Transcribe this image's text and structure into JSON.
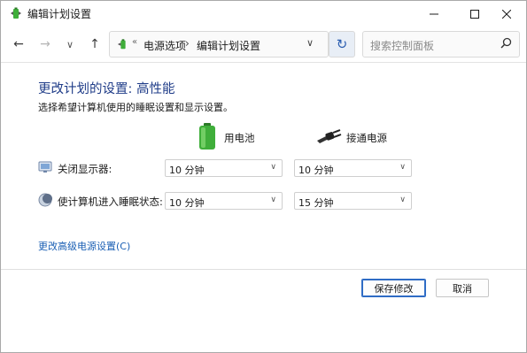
{
  "window": {
    "title": "编辑计划设置"
  },
  "nav": {
    "breadcrumb": [
      "电源选项",
      "编辑计划设置"
    ],
    "search_placeholder": "搜索控制面板",
    "refresh_color": "#2a5db0"
  },
  "main": {
    "title": "更改计划的设置: 高性能",
    "subtitle": "选择希望计算机使用的睡眠设置和显示设置。",
    "columns": {
      "battery": "用电池",
      "plugged_in": "接通电源"
    },
    "rows": [
      {
        "label": "关闭显示器:",
        "battery_value": "10 分钟",
        "plugged_value": "10 分钟",
        "icon": "monitor-icon"
      },
      {
        "label": "使计算机进入睡眠状态:",
        "battery_value": "10 分钟",
        "plugged_value": "15 分钟",
        "icon": "moon-sleep-icon"
      }
    ],
    "advanced_link": "更改高级电源设置(C)"
  },
  "footer": {
    "save_label": "保存修改",
    "cancel_label": "取消"
  },
  "colors": {
    "title_blue": "#1f3c88",
    "link_blue": "#1a5fb4",
    "primary_border": "#2f6cc5",
    "battery_green": "#3fae3a"
  }
}
